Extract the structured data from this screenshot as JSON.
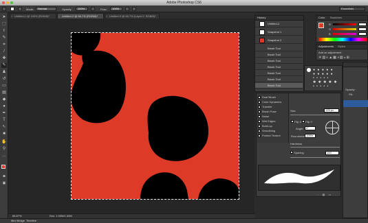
{
  "app": {
    "title": "Adobe Photoshop CS6",
    "workspace": "Essentials"
  },
  "options": {
    "mode_label": "Mode:",
    "mode_value": "Normal",
    "opacity_label": "Opacity:",
    "opacity_value": "100%",
    "flow_label": "Flow:",
    "flow_value": "100%"
  },
  "tabs": [
    {
      "label": "Untitled-1 @ 100% (RGB/8)*"
    },
    {
      "label": "Untitled-2 @ 66.7% (RGB/8)*"
    },
    {
      "label": "Untitled-3 @ 66.7% (Layer 0, RGB/8)*"
    }
  ],
  "status": {
    "zoom": "66.67%",
    "doc": "Doc: 1.03M/1.00M"
  },
  "bottom": {
    "mini_bridge": "Mini Bridge",
    "timeline": "Timeline"
  },
  "history": {
    "tabs": [
      "History",
      "Actions"
    ],
    "rows": [
      "Untitled-2",
      "Snapshot 1",
      "Snapshot 2",
      "Brush Tool",
      "Brush Tool",
      "Brush Tool",
      "Brush Tool",
      "Brush Tool",
      "Brush Tool",
      "Brush Tool"
    ]
  },
  "color_panel": {
    "tabs": [
      "Color",
      "Swatches"
    ],
    "r": "R",
    "g": "G",
    "b": "B"
  },
  "adjustments": {
    "tabs": [
      "Adjustments",
      "Styles"
    ],
    "add": "Add an adjustment"
  },
  "brush": {
    "options": [
      "Dual Brush",
      "Color Dynamics",
      "Transfer",
      "Brush Pose",
      "Noise",
      "Wet Edges",
      "Build-up",
      "Smoothing",
      "Protect Texture"
    ],
    "size_label": "Size",
    "size_value": "125 px",
    "flipx": "Flip X",
    "flipy": "Flip Y",
    "angle_label": "Angle:",
    "angle_value": "0°",
    "roundness_label": "Roundness:",
    "roundness_value": "100%",
    "hardness_label": "Hardness",
    "spacing_label": "Spacing",
    "spacing_value": "100"
  },
  "layers": {
    "opacity_label": "Opacity:",
    "fill_label": "Fill:"
  },
  "colors": {
    "canvas": "#dd3b27",
    "fg": "#dd3b27",
    "bg": "#000000"
  }
}
